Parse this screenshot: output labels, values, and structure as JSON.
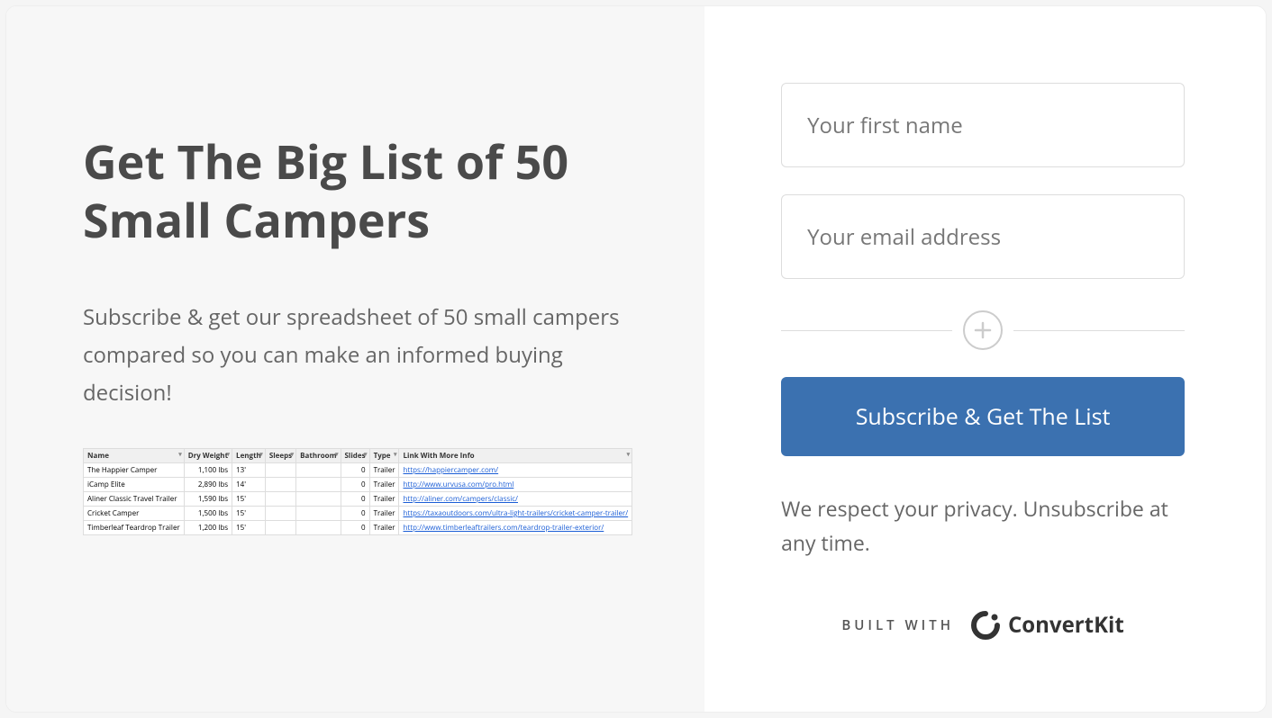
{
  "left": {
    "heading": "Get The Big List of 50 Small Campers",
    "subheading": "Subscribe & get our spreadsheet of 50 small campers compared so you can make an informed buying decision!",
    "spreadsheet": {
      "headers": [
        "Name",
        "Dry Weight",
        "Length",
        "Sleeps",
        "Bathroom",
        "Slides",
        "Type",
        "Link With More Info"
      ],
      "rows": [
        {
          "name": "The Happier Camper",
          "weight": "1,100 lbs",
          "length": "13'",
          "sleeps": "",
          "bathroom": "",
          "slides": "0",
          "type": "Trailer",
          "link": "https://happiercamper.com/"
        },
        {
          "name": "iCamp Elite",
          "weight": "2,890 lbs",
          "length": "14'",
          "sleeps": "",
          "bathroom": "",
          "slides": "0",
          "type": "Trailer",
          "link": "http://www.urvusa.com/pro.html"
        },
        {
          "name": "Aliner Classic Travel Trailer",
          "weight": "1,590 lbs",
          "length": "15'",
          "sleeps": "",
          "bathroom": "",
          "slides": "0",
          "type": "Trailer",
          "link": "http://aliner.com/campers/classic/"
        },
        {
          "name": "Cricket Camper",
          "weight": "1,500 lbs",
          "length": "15'",
          "sleeps": "",
          "bathroom": "",
          "slides": "0",
          "type": "Trailer",
          "link": "https://taxaoutdoors.com/ultra-light-trailers/cricket-camper-trailer/"
        },
        {
          "name": "Timberleaf Teardrop Trailer",
          "weight": "1,200 lbs",
          "length": "15'",
          "sleeps": "",
          "bathroom": "",
          "slides": "0",
          "type": "Trailer",
          "link": "http://www.timberleaftrailers.com/teardrop-trailer-exterior/"
        }
      ]
    }
  },
  "form": {
    "first_name_placeholder": "Your first name",
    "email_placeholder": "Your email address",
    "submit_label": "Subscribe & Get The List",
    "privacy_text": "We respect your privacy. Unsubscribe at any time."
  },
  "footer": {
    "built_with_label": "BUILT WITH",
    "brand": "ConvertKit"
  }
}
